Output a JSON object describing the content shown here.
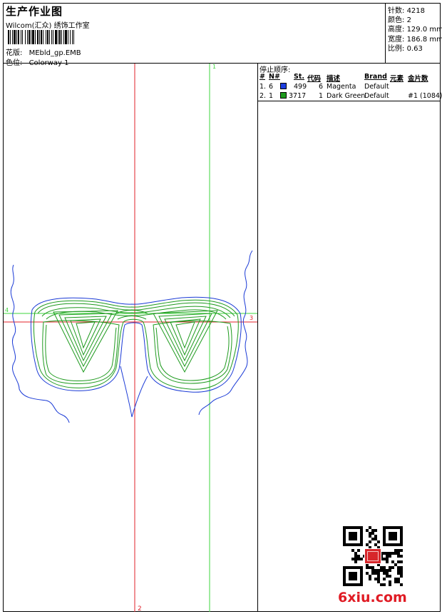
{
  "header": {
    "title": "生产作业图",
    "company": "Wilcom(汇众) 绣饰工作室",
    "design_label": "花版:",
    "design_value": "MEbld_gp.EMB",
    "colorway_label": "色位:",
    "colorway_value": "Colorway 1"
  },
  "stats": [
    {
      "label": "针数:",
      "value": "4218"
    },
    {
      "label": "颜色:",
      "value": "2"
    },
    {
      "label": "高度:",
      "value": "129.0 mm"
    },
    {
      "label": "宽度:",
      "value": "186.8 mm"
    },
    {
      "label": "比例:",
      "value": "0.63"
    }
  ],
  "canvas": {
    "marker_top": "1",
    "marker_bottom": "2",
    "marker_left": "4",
    "marker_right": "3",
    "colors": {
      "red": "#e0222a",
      "green": "#3dd63d",
      "blue": "#1a3ad6",
      "stitch_green": "#1e9a1e"
    }
  },
  "stop_sequence": {
    "title": "停止顺序:",
    "columns": [
      "#",
      "N#",
      "St.",
      "代码",
      "描述",
      "Brand",
      "元素",
      "金片数"
    ],
    "rows": [
      {
        "idx": "1.",
        "needle": "6",
        "color": "#1d3fe0",
        "stitches": "499",
        "code": "6",
        "desc": "Magenta",
        "brand": "Default",
        "element": "",
        "sequins": ""
      },
      {
        "idx": "2.",
        "needle": "1",
        "color": "#1d9a1d",
        "stitches": "3717",
        "code": "1",
        "desc": "Dark Green",
        "brand": "Default",
        "element": "",
        "sequins": "#1 (1084)"
      }
    ]
  },
  "watermark": {
    "text": "6xiu.com"
  }
}
